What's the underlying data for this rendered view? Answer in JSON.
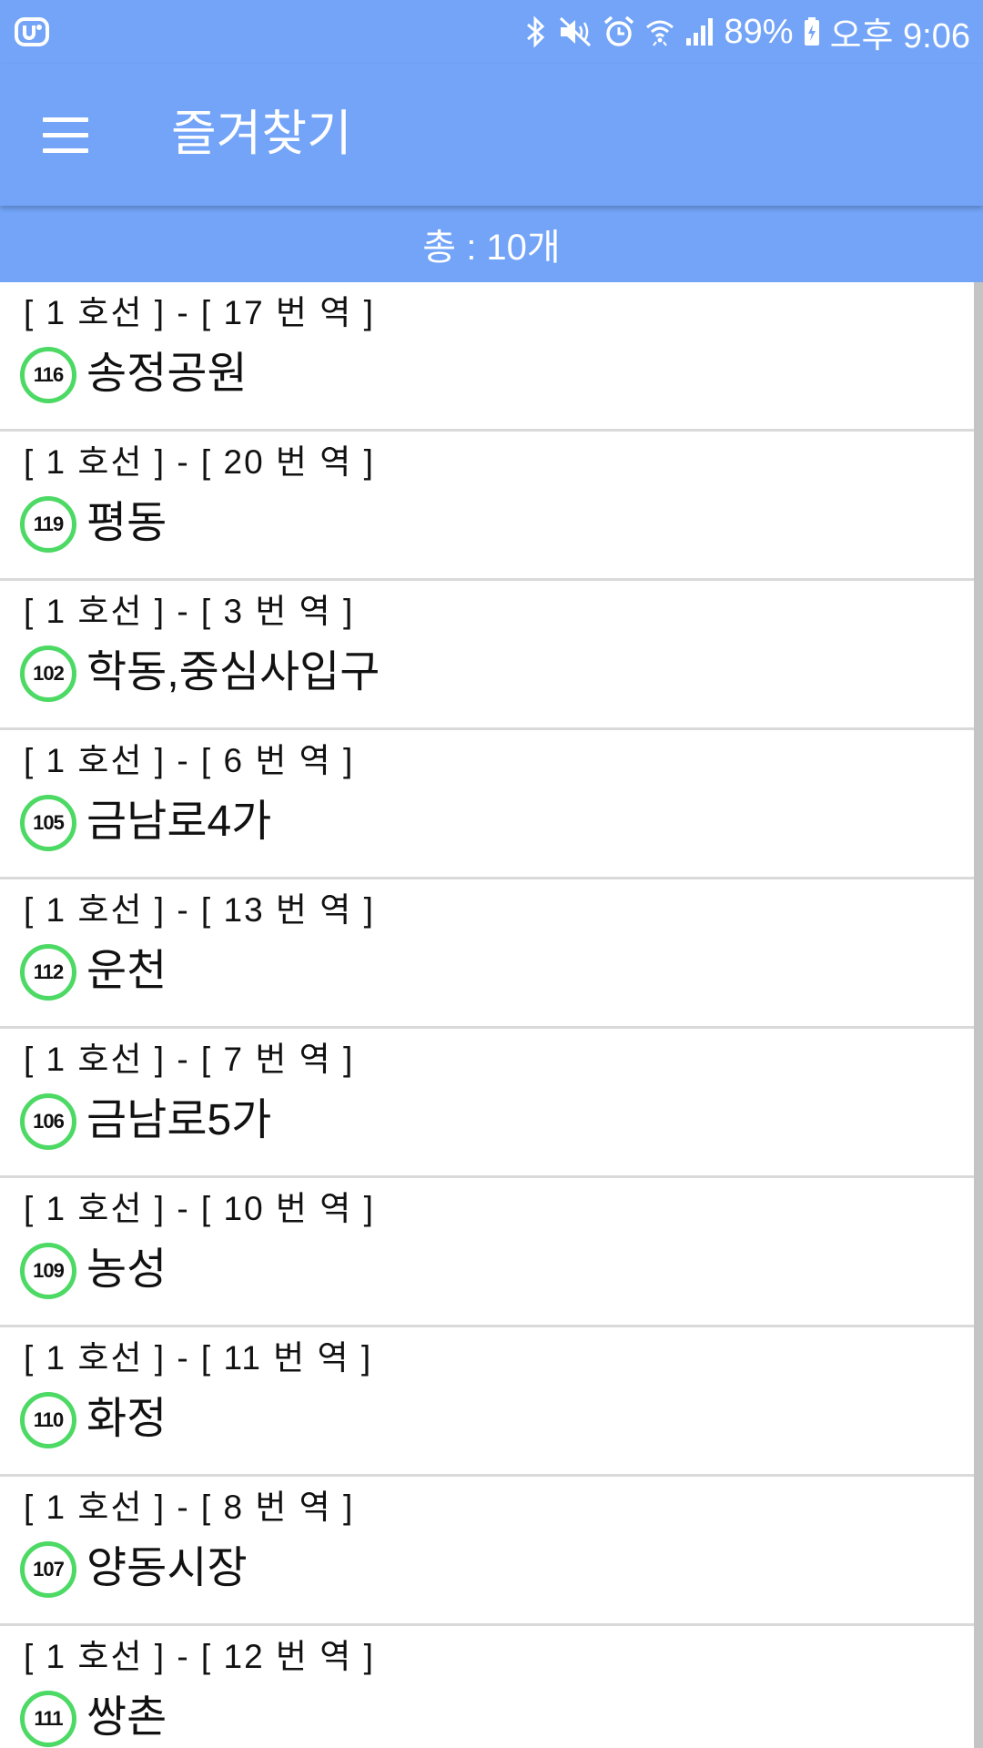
{
  "status_bar": {
    "app_icon": "u-plus-icon",
    "icons": [
      "bluetooth-icon",
      "mute-icon",
      "alarm-icon",
      "wifi-icon",
      "signal-icon",
      "battery-charging-icon"
    ],
    "battery": "89%",
    "time": "오후 9:06"
  },
  "app_bar": {
    "menu_icon": "hamburger-menu-icon",
    "title": "즐겨찾기"
  },
  "summary": {
    "count_text": "총 : 10개"
  },
  "accent_colors": {
    "header": "#73a4f8",
    "line_badge": "#4cd964"
  },
  "favorites": [
    {
      "line_station": "[ 1 호선 ] - [ 17 번 역 ]",
      "code": "116",
      "name": "송정공원"
    },
    {
      "line_station": "[ 1 호선 ] - [ 20 번 역 ]",
      "code": "119",
      "name": "평동"
    },
    {
      "line_station": "[ 1 호선 ] - [ 3 번 역 ]",
      "code": "102",
      "name": "학동,중심사입구"
    },
    {
      "line_station": "[ 1 호선 ] - [ 6 번 역 ]",
      "code": "105",
      "name": "금남로4가"
    },
    {
      "line_station": "[ 1 호선 ] - [ 13 번 역 ]",
      "code": "112",
      "name": "운천"
    },
    {
      "line_station": "[ 1 호선 ] - [ 7 번 역 ]",
      "code": "106",
      "name": "금남로5가"
    },
    {
      "line_station": "[ 1 호선 ] - [ 10 번 역 ]",
      "code": "109",
      "name": "농성"
    },
    {
      "line_station": "[ 1 호선 ] - [ 11 번 역 ]",
      "code": "110",
      "name": "화정"
    },
    {
      "line_station": "[ 1 호선 ] - [ 8 번 역 ]",
      "code": "107",
      "name": "양동시장"
    },
    {
      "line_station": "[ 1 호선 ] - [ 12 번 역 ]",
      "code": "111",
      "name": "쌍촌"
    }
  ]
}
